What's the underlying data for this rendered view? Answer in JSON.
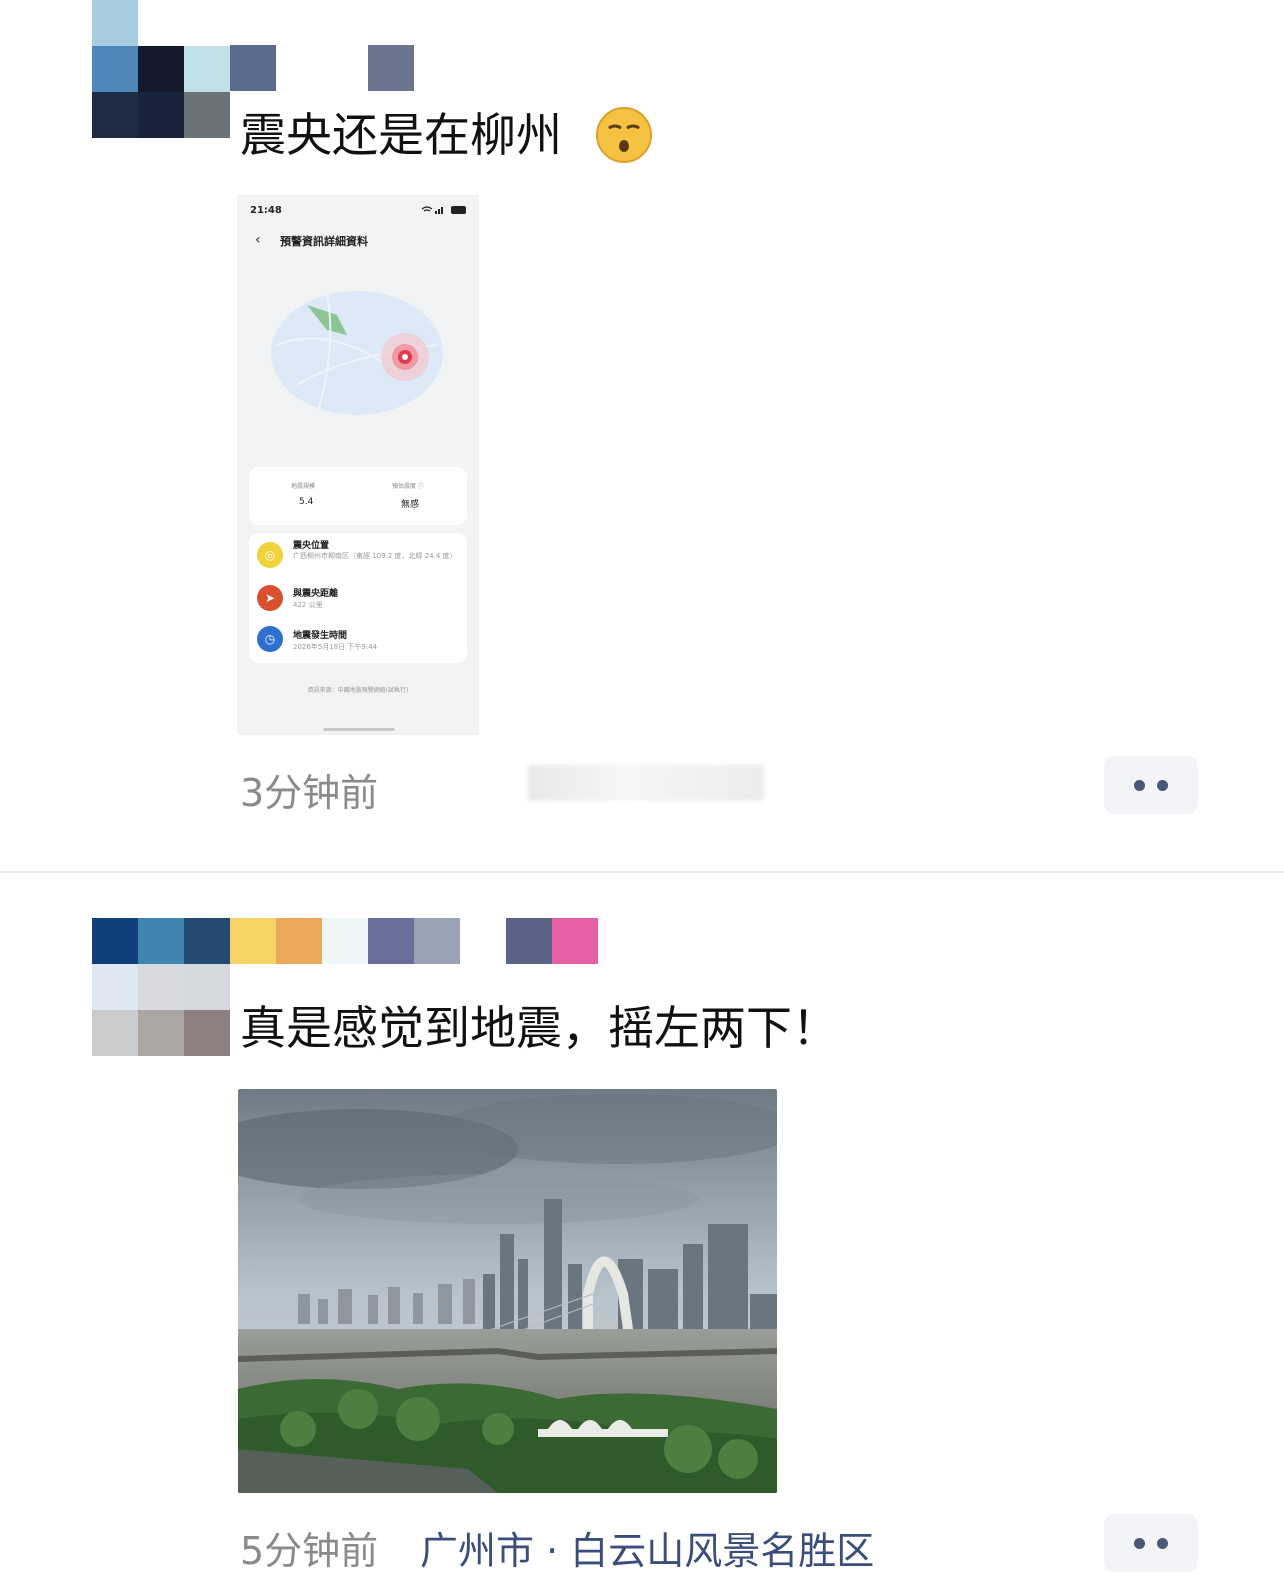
{
  "posts": [
    {
      "text": "震央还是在柳州",
      "time": "3分钟前",
      "attachment": {
        "status_time": "21:48",
        "status_icons": "Wi-Fi · 5G · 96",
        "page_title": "預警資訊詳細資料",
        "stats": [
          {
            "label": "地震規模",
            "value": "5.4"
          },
          {
            "label": "預估震度 ⓘ",
            "value": "無感"
          }
        ],
        "details": [
          {
            "icon": "epicenter-icon",
            "title": "震央位置",
            "value": "广西柳州市柳南区（東經 109.2 度，北緯 24.4 度）",
            "color": "#f0d23a"
          },
          {
            "icon": "distance-icon",
            "title": "與震央距離",
            "value": "422 公里",
            "color": "#d9502f"
          },
          {
            "icon": "clock-icon",
            "title": "地震發生時間",
            "value": "2026年5月18日 下午9:44",
            "color": "#2f6fd0"
          }
        ],
        "source": "資訊來源：中國地震預警網絡(試執行)"
      }
    },
    {
      "text": "真是感觉到地震，摇左两下！",
      "time": "5分钟前",
      "location": "广州市 · 白云山风景名胜区"
    }
  ],
  "colors": {
    "text": "#111111",
    "meta": "#8a8a8a",
    "location": "#3b4d7a",
    "more_bg": "#f3f4f7"
  }
}
